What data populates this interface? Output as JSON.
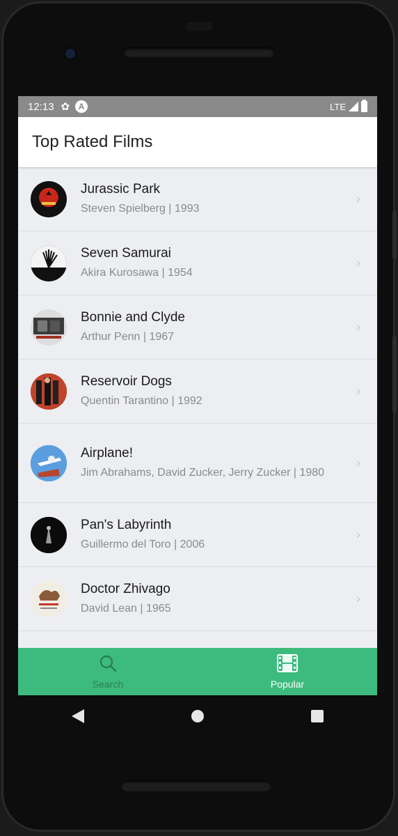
{
  "status_bar": {
    "time": "12:13",
    "network": "LTE"
  },
  "header": {
    "title": "Top Rated Films"
  },
  "films": [
    {
      "title": "Jurassic Park",
      "subtitle": "Steven Spielberg | 1993"
    },
    {
      "title": "Seven Samurai",
      "subtitle": "Akira Kurosawa | 1954"
    },
    {
      "title": "Bonnie and Clyde",
      "subtitle": "Arthur Penn | 1967"
    },
    {
      "title": "Reservoir Dogs",
      "subtitle": "Quentin Tarantino | 1992"
    },
    {
      "title": "Airplane!",
      "subtitle": "Jim Abrahams, David Zucker, Jerry Zucker | 1980"
    },
    {
      "title": "Pan's Labyrinth",
      "subtitle": "Guillermo del Toro | 2006"
    },
    {
      "title": "Doctor Zhivago",
      "subtitle": "David Lean | 1965"
    }
  ],
  "bottom_nav": {
    "search_label": "Search",
    "popular_label": "Popular",
    "active_tab": "Popular",
    "accent_color": "#3dbb7e"
  },
  "icons": [
    "settings-icon",
    "a-icon",
    "signal-icon",
    "battery-icon",
    "chevron-right-icon",
    "search-icon",
    "film-icon",
    "back-icon",
    "home-icon",
    "recents-icon"
  ]
}
